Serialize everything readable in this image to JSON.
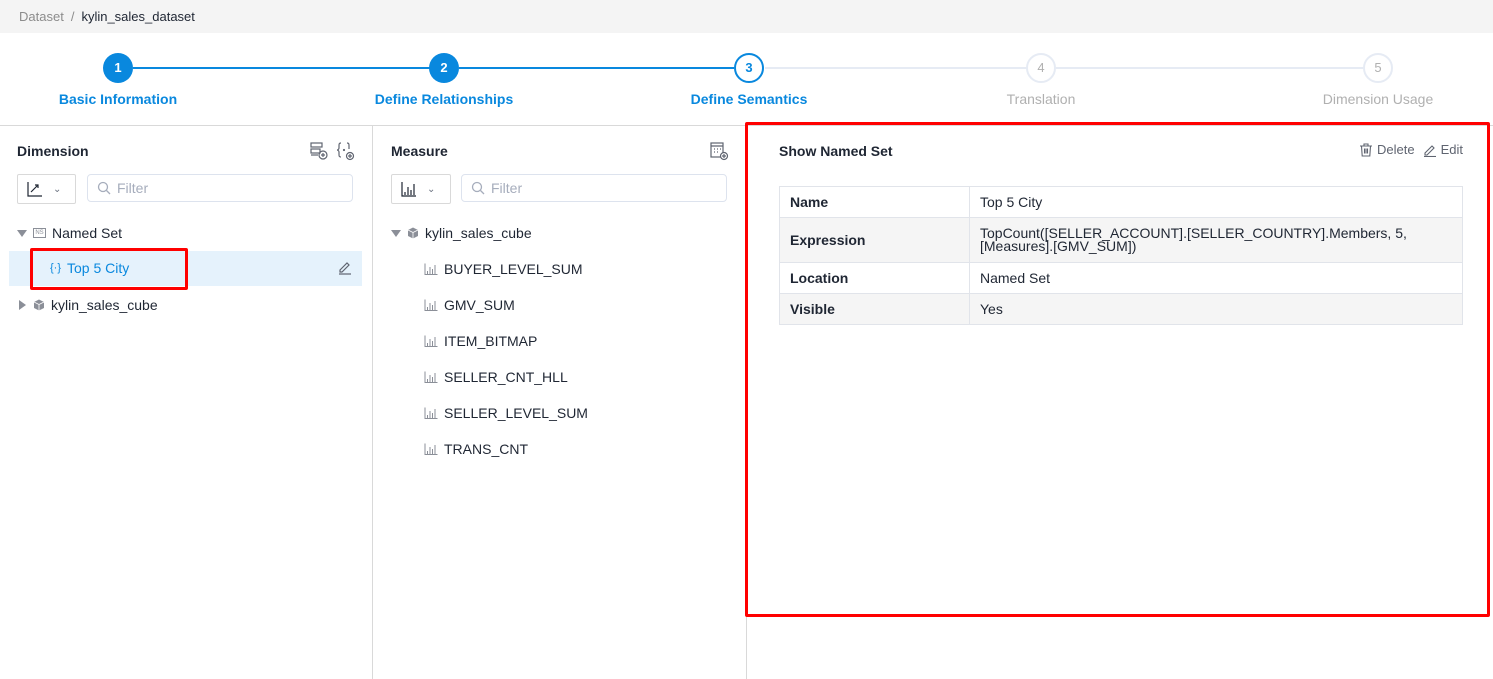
{
  "breadcrumb": {
    "root": "Dataset",
    "separator": "/",
    "current": "kylin_sales_dataset"
  },
  "steps": [
    {
      "number": "1",
      "label": "Basic Information",
      "state": "done"
    },
    {
      "number": "2",
      "label": "Define Relationships",
      "state": "done"
    },
    {
      "number": "3",
      "label": "Define Semantics",
      "state": "active"
    },
    {
      "number": "4",
      "label": "Translation",
      "state": "todo"
    },
    {
      "number": "5",
      "label": "Dimension Usage",
      "state": "todo"
    }
  ],
  "dimension_panel": {
    "title": "Dimension",
    "header_icons": [
      "add-hierarchy-icon",
      "add-named-set-icon"
    ],
    "type_select_icon": "dimension-trend-icon",
    "filter_placeholder": "Filter",
    "tree": [
      {
        "label": "Named Set",
        "icon": "named-set-icon",
        "expanded": true,
        "children": [
          {
            "label": "Top 5 City",
            "icon": "named-set-brace-icon",
            "selected": true
          }
        ]
      },
      {
        "label": "kylin_sales_cube",
        "icon": "cube-icon",
        "expanded": false
      }
    ]
  },
  "measure_panel": {
    "title": "Measure",
    "header_icons": [
      "add-calculated-measure-icon"
    ],
    "type_select_icon": "bar-chart-icon",
    "filter_placeholder": "Filter",
    "cube": "kylin_sales_cube",
    "measures": [
      "BUYER_LEVEL_SUM",
      "GMV_SUM",
      "ITEM_BITMAP",
      "SELLER_CNT_HLL",
      "SELLER_LEVEL_SUM",
      "TRANS_CNT"
    ]
  },
  "detail_panel": {
    "title": "Show Named Set",
    "delete_label": "Delete",
    "edit_label": "Edit",
    "rows": [
      {
        "key": "Name",
        "value": "Top 5 City"
      },
      {
        "key": "Expression",
        "value_line1": "TopCount([SELLER_ACCOUNT].[SELLER_COUNTRY].Members, 5,",
        "value_line2": "[Measures].[GMV_SUM])"
      },
      {
        "key": "Location",
        "value": "Named Set"
      },
      {
        "key": "Visible",
        "value": "Yes"
      }
    ]
  },
  "colors": {
    "accent": "#0988de",
    "highlight_box": "#ff0000",
    "selected_row_bg": "#e5f2fc",
    "inactive_step": "#b0b0b0"
  }
}
